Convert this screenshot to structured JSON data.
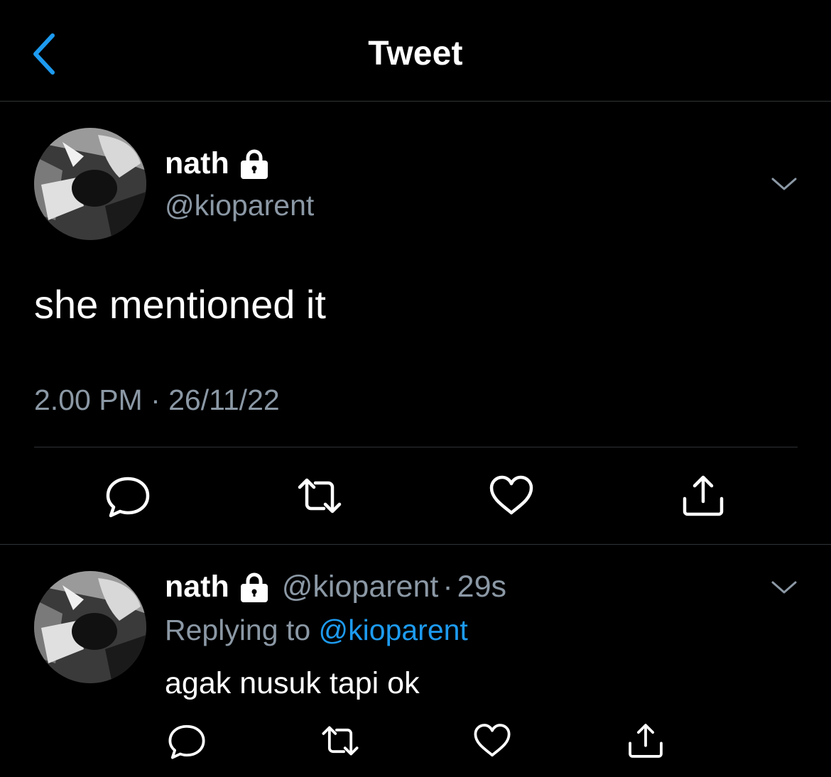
{
  "header": {
    "title": "Tweet",
    "back_icon": "chevron-left-icon",
    "accent_color": "#1d9bf0"
  },
  "main_tweet": {
    "author_name": "nath",
    "author_handle": "@kioparent",
    "protected_icon": "lock-icon",
    "text": "she mentioned it",
    "timestamp": "2.00 PM · 26/11/22",
    "menu_icon": "chevron-down-icon",
    "actions": [
      "reply-icon",
      "retweet-icon",
      "like-icon",
      "share-icon"
    ]
  },
  "reply": {
    "author_name": "nath",
    "author_handle": "@kioparent",
    "separator": "·",
    "age": "29s",
    "replying_prefix": "Replying to",
    "replying_to": "@kioparent",
    "text": "agak nusuk tapi ok",
    "menu_icon": "chevron-down-icon",
    "actions": [
      "reply-icon",
      "retweet-icon",
      "like-icon",
      "share-icon"
    ]
  },
  "colors": {
    "background": "#000000",
    "text_primary": "#ffffff",
    "text_secondary": "#8b98a5",
    "link": "#1d9bf0",
    "divider": "#2f3336"
  }
}
